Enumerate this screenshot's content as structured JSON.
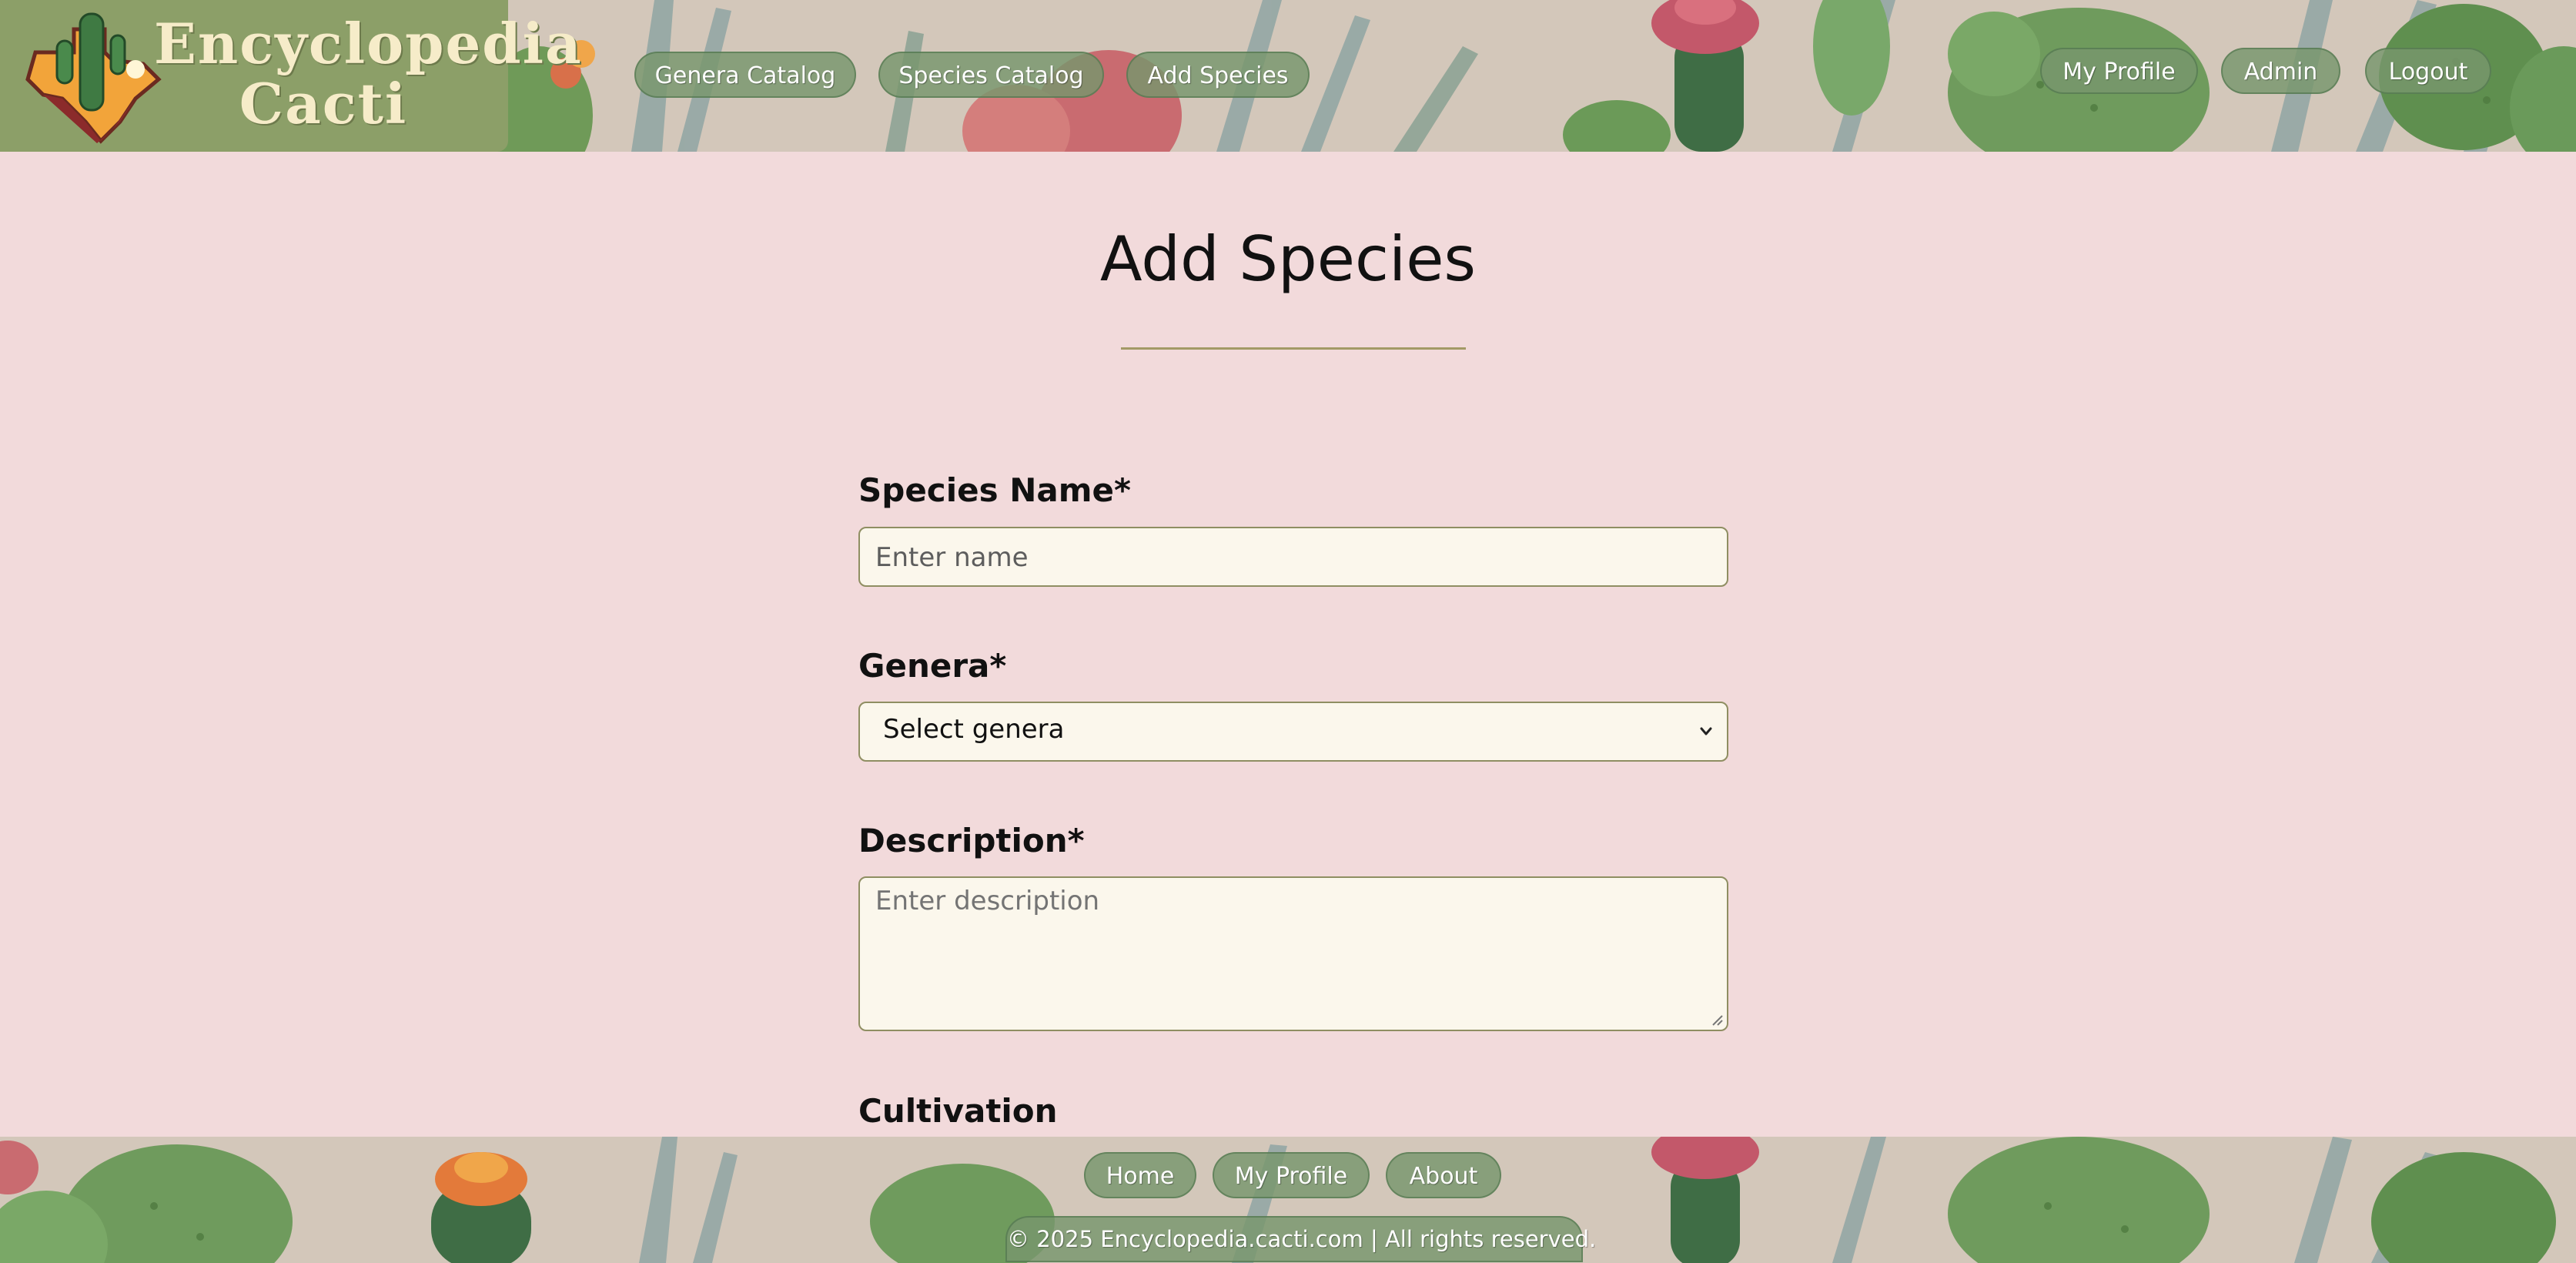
{
  "brand": {
    "line1": "Encyclopedia",
    "line2": "Cacti"
  },
  "nav": {
    "left": [
      "Genera Catalog",
      "Species Catalog",
      "Add Species"
    ],
    "right": [
      "My Profile",
      "Admin",
      "Logout"
    ]
  },
  "page": {
    "title": "Add Species"
  },
  "form": {
    "species_name": {
      "label": "Species Name*",
      "placeholder": "Enter name",
      "value": ""
    },
    "genera": {
      "label": "Genera*",
      "selected": "Select genera"
    },
    "description": {
      "label": "Description*",
      "placeholder": "Enter description",
      "value": ""
    },
    "cultivation": {
      "label": "Cultivation"
    }
  },
  "footer": {
    "links": [
      "Home",
      "My Profile",
      "About"
    ],
    "copyright": "© 2025 Encyclopedia.cacti.com | All rights reserved."
  },
  "colors": {
    "page_background": "#f2dadb",
    "header_brand_box": "#8c9f68",
    "pill_button": "#78966c",
    "field_background": "#fbf7ec",
    "field_border": "#8f8e62",
    "title_rule": "#a39a66"
  },
  "icons": {
    "logo": "texas-cactus-logo-icon",
    "select_arrow": "chevron-down-icon",
    "textarea_resize": "resize-grip-icon"
  }
}
